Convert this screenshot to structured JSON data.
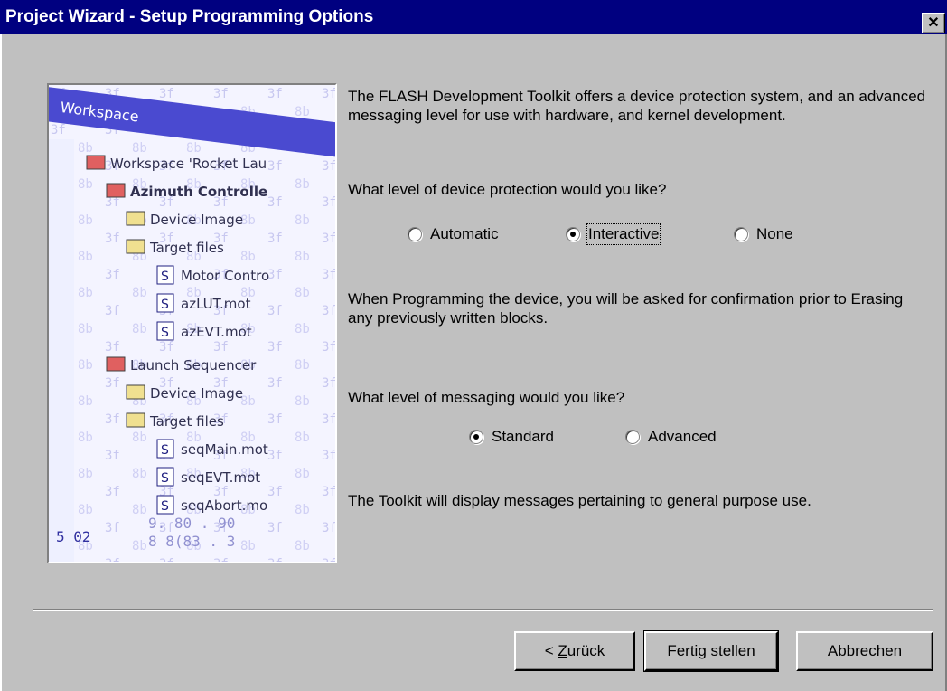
{
  "window": {
    "title": "Project Wizard - Setup Programming Options",
    "close_label": "✕"
  },
  "illustration": {
    "workspace_tab": "Workspace",
    "tree": [
      {
        "label": "Workspace 'Rocket Lau",
        "level": 0,
        "icon": "workspace-icon"
      },
      {
        "label": "Azimuth Controlle",
        "level": 1,
        "icon": "project-icon"
      },
      {
        "label": "Device Image",
        "level": 2,
        "icon": "folder-icon"
      },
      {
        "label": "Target files",
        "level": 2,
        "icon": "folder-open-icon"
      },
      {
        "label": "Motor Contro",
        "level": 3,
        "icon": "s-record-icon"
      },
      {
        "label": "azLUT.mot",
        "level": 3,
        "icon": "s-record-icon"
      },
      {
        "label": "azEVT.mot",
        "level": 3,
        "icon": "s-record-icon"
      },
      {
        "label": "Launch Sequencer",
        "level": 1,
        "icon": "project-icon"
      },
      {
        "label": "Device Image",
        "level": 2,
        "icon": "folder-icon"
      },
      {
        "label": "Target files",
        "level": 2,
        "icon": "folder-open-icon"
      },
      {
        "label": "seqMain.mot",
        "level": 3,
        "icon": "s-record-icon"
      },
      {
        "label": "seqEVT.mot",
        "level": 3,
        "icon": "s-record-icon"
      },
      {
        "label": "seqAbort.mo",
        "level": 3,
        "icon": "s-record-icon"
      }
    ]
  },
  "intro_text": "The FLASH Development Toolkit offers a device protection system, and an advanced messaging level for use with hardware, and kernel development.",
  "protection": {
    "question": "What level of device protection would you like?",
    "options": [
      {
        "label": "Automatic",
        "checked": false
      },
      {
        "label": "Interactive",
        "checked": true
      },
      {
        "label": "None",
        "checked": false
      }
    ],
    "description": "When Programming the device, you will be asked for confirmation prior to Erasing any previously written blocks."
  },
  "messaging": {
    "question": "What level of messaging would you like?",
    "options": [
      {
        "label": "Standard",
        "checked": true
      },
      {
        "label": "Advanced",
        "checked": false
      }
    ],
    "description": "The Toolkit will display messages pertaining to general purpose use."
  },
  "buttons": {
    "back_prefix": "< ",
    "back_mnemonic": "Z",
    "back_rest": "urück",
    "finish": "Fertig stellen",
    "cancel": "Abbrechen"
  },
  "colors": {
    "title_bar": "#000080",
    "dialog_bg": "#c0c0c0",
    "illustration_highlight": "#4040c0"
  }
}
